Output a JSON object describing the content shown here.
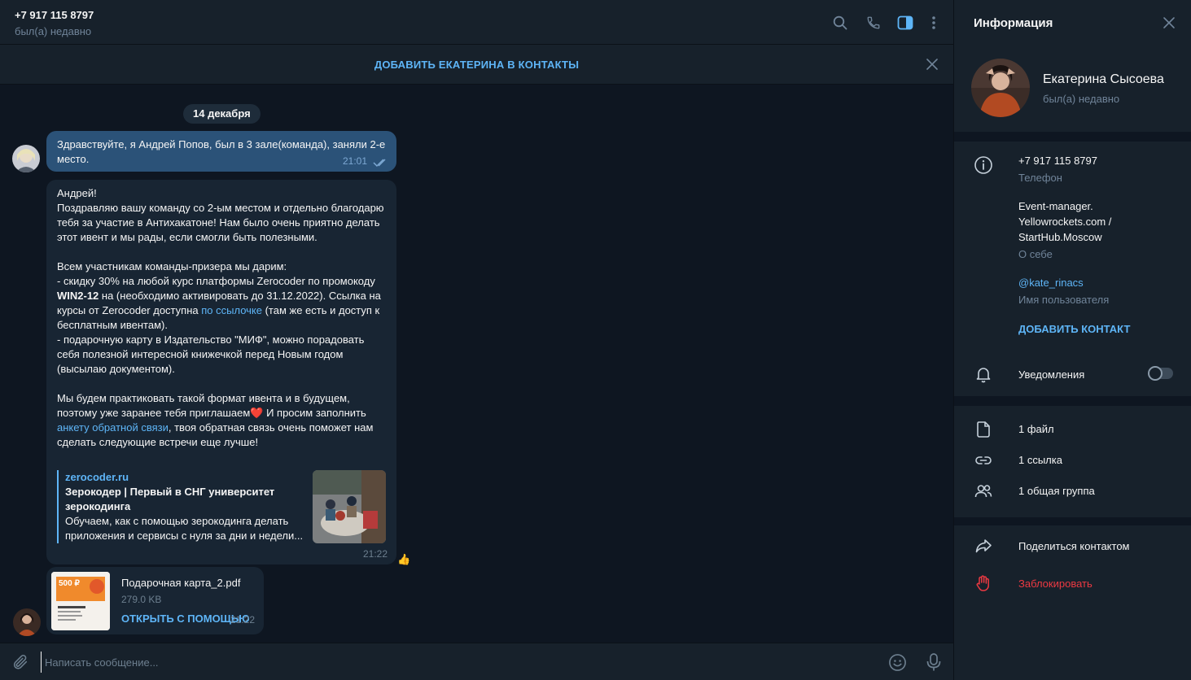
{
  "chat": {
    "phone": "+7 917 115 8797",
    "status": "был(а) недавно",
    "add_contact_banner": "ДОБАВИТЬ ЕКАТЕРИНА В КОНТАКТЫ",
    "date_divider": "14 декабря"
  },
  "messages": {
    "outgoing": {
      "text": "Здравствуйте, я Андрей Попов, был в 3 зале(команда), заняли 2-е место.",
      "time": "21:01"
    },
    "incoming": {
      "greeting": "Андрей!",
      "p1": "Поздравляю вашу команду со 2-ым местом и отдельно благодарю тебя за участие в Антихакатоне! Нам было очень приятно делать этот ивент и мы рады, если смогли быть полезными.",
      "p2": "Всем участникам команды-призера мы дарим:",
      "p3_a": "- скидку 30% на любой курс платформы Zerocoder по промокоду ",
      "promo": "WIN2-12",
      "p3_b": " на (необходимо активировать до 31.12.2022). Ссылка на курсы от Zerocoder доступна ",
      "p3_link": "по ссылочке",
      "p3_c": " (там же есть и доступ к бесплатным ивентам).",
      "p4": "- подарочную карту в Издательство \"МИФ\", можно порадовать себя полезной интересной книжечкой перед Новым годом (высылаю документом).",
      "p5_a": "Мы будем практиковать такой формат ивента и в будущем, поэтому уже заранее тебя приглашаем",
      "p5_b": " И просим заполнить ",
      "p5_link": "анкету обратной связи",
      "p5_c": ", твоя обратная связь очень поможет нам сделать следующие встречи еще лучше!",
      "heart": "❤️",
      "preview_site": "zerocoder.ru",
      "preview_title": "Зерокодер | Первый в СНГ университет зерокодинга",
      "preview_desc_1": "Обучаем, как с помощью зерокодинга делать",
      "preview_desc_2": "приложения и сервисы с нуля за дни и недели...",
      "time": "21:22",
      "reaction": "👍"
    },
    "file": {
      "name": "Подарочная карта_2.pdf",
      "size": "279.0 KB",
      "action": "ОТКРЫТЬ С ПОМОЩЬЮ",
      "time": "21:22",
      "thumb_label": "500 ₽"
    }
  },
  "composer": {
    "placeholder": "Написать сообщение..."
  },
  "info": {
    "title": "Информация",
    "name": "Екатерина Сысоева",
    "status": "был(а) недавно",
    "phone": "+7 917 115 8797",
    "phone_label": "Телефон",
    "bio_line1": "Event-manager.",
    "bio_line2": "Yellowrockets.com /",
    "bio_line3": "StartHub.Moscow",
    "bio_label": "О себе",
    "username": "@kate_rinacs",
    "username_label": "Имя пользователя",
    "add_contact": "ДОБАВИТЬ КОНТАКТ",
    "notifications": "Уведомления",
    "notifications_on": false,
    "files": "1 файл",
    "links": "1 ссылка",
    "groups": "1 общая группа",
    "share": "Поделиться контактом",
    "block": "Заблокировать"
  },
  "colors": {
    "accent": "#5eb5f7",
    "outgoing_bubble": "#2b5278",
    "incoming_bubble": "#182533",
    "background": "#0e1621",
    "panel": "#17212b",
    "danger": "#ec3942"
  },
  "icons": [
    "search-icon",
    "phone-icon",
    "sidebar-toggle-icon",
    "more-icon",
    "close-icon",
    "attach-icon",
    "emoji-icon",
    "mic-icon",
    "info-icon",
    "bell-icon",
    "file-icon",
    "link-icon",
    "group-icon",
    "share-icon",
    "block-hand-icon"
  ]
}
